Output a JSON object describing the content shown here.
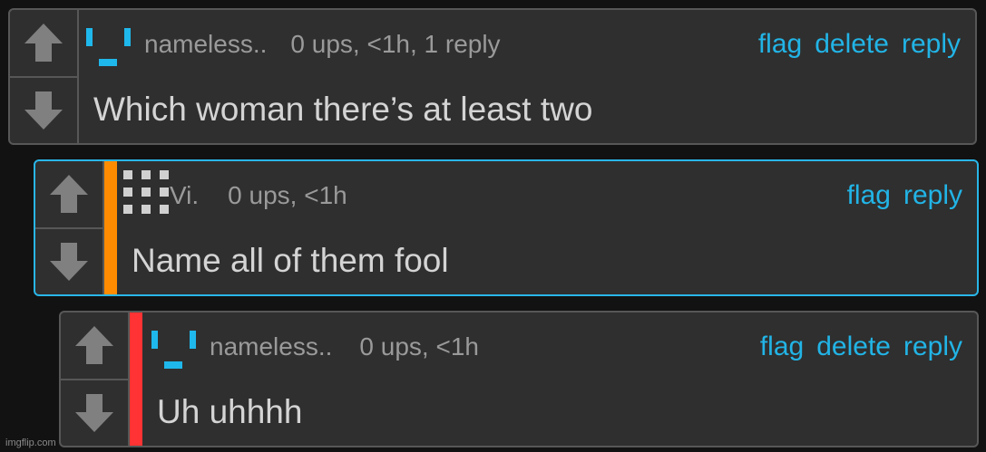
{
  "comments": [
    {
      "username": "nameless..",
      "meta": "0 ups, <1h, 1 reply",
      "actions": [
        "flag",
        "delete",
        "reply"
      ],
      "text": "Which woman there’s at least two",
      "avatar_icon": "face-icon",
      "avatar_color": "#1fb8ec"
    },
    {
      "username": "Vi.",
      "meta": "0 ups, <1h",
      "actions": [
        "flag",
        "reply"
      ],
      "text": "Name all of them fool",
      "avatar_icon": "dot-grid-icon",
      "avatar_color": "#d0d0d0",
      "stripe_color": "#ff8c00",
      "highlight_color": "#29b6e8"
    },
    {
      "username": "nameless..",
      "meta": "0 ups, <1h",
      "actions": [
        "flag",
        "delete",
        "reply"
      ],
      "text": "Uh uhhhh",
      "avatar_icon": "face-icon",
      "avatar_color": "#1fb8ec",
      "stripe_color": "#ff3333"
    }
  ],
  "watermark": "imgflip.com",
  "colors": {
    "background": "#121212",
    "card": "#2f2f2f",
    "border": "#575757",
    "link": "#22b4e6",
    "meta": "#9a9a9a",
    "text": "#d4d4d4"
  }
}
